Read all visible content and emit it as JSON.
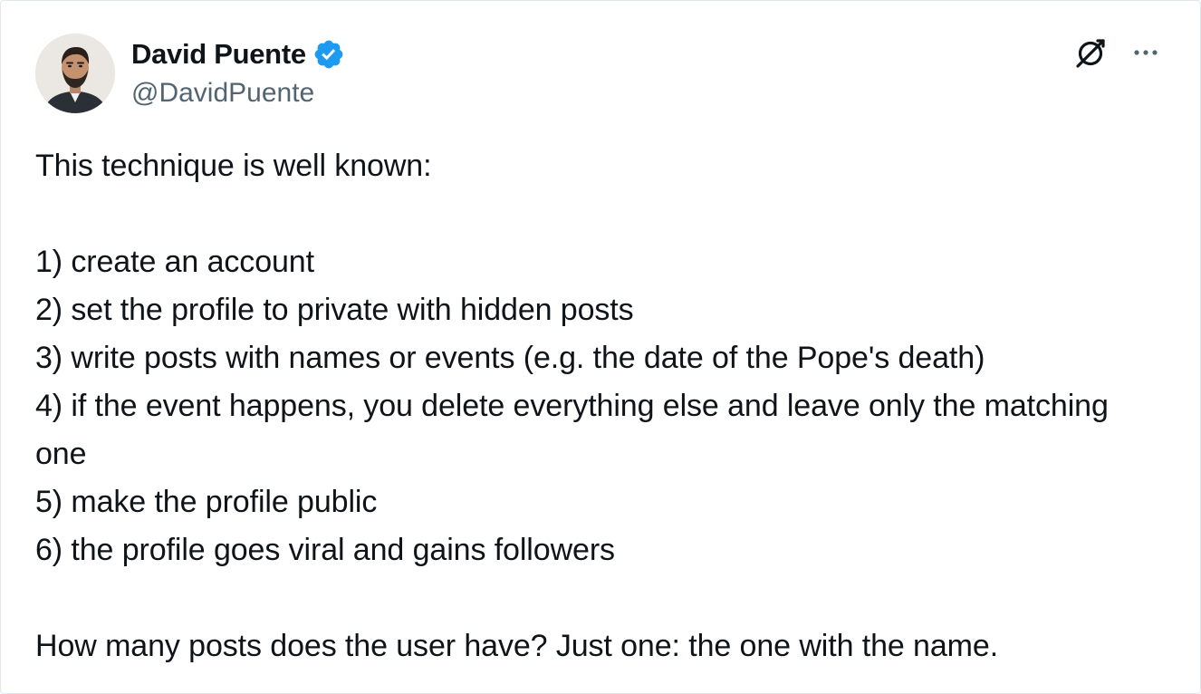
{
  "author": {
    "display_name": "David Puente",
    "handle": "@DavidPuente",
    "verified": true,
    "avatar_icon": "avatar-photo"
  },
  "actions": {
    "grok_icon": "grok-icon",
    "more_icon": "more-options-icon"
  },
  "tweet": {
    "intro": "This technique is well known:",
    "steps": [
      "1) create an account",
      "2) set the profile to private with hidden posts",
      "3) write posts with names or events (e.g. the date of the Pope's death)",
      "4) if the event happens, you delete everything else and leave only the matching one",
      "5) make the profile public",
      "6) the profile goes viral and gains followers"
    ],
    "conclusion": "How many posts does the user have? Just one: the one with the name."
  },
  "colors": {
    "text": "#0f1419",
    "secondary": "#536471",
    "verified_blue": "#1d9bf0",
    "border": "#e1e8ed"
  }
}
